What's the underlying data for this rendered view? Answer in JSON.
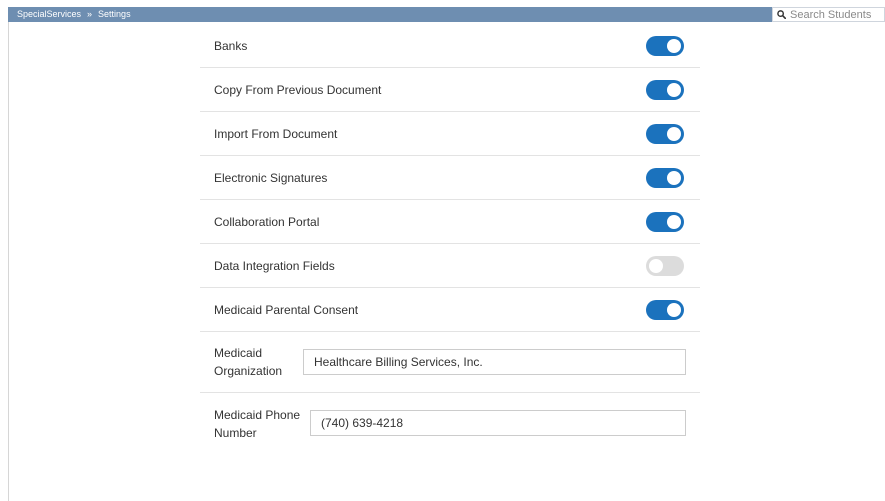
{
  "breadcrumb": {
    "app": "SpecialServices",
    "separator": "»",
    "page": "Settings"
  },
  "search": {
    "placeholder": "Search Students",
    "icon": "search-icon"
  },
  "colors": {
    "topbar": "#6e8eb1",
    "toggle_on": "#1b72bd",
    "toggle_off": "#dcdcdc"
  },
  "settings": [
    {
      "label": "Banks",
      "enabled": true
    },
    {
      "label": "Copy From Previous Document",
      "enabled": true
    },
    {
      "label": "Import From Document",
      "enabled": true
    },
    {
      "label": "Electronic Signatures",
      "enabled": true
    },
    {
      "label": "Collaboration Portal",
      "enabled": true
    },
    {
      "label": "Data Integration Fields",
      "enabled": false
    },
    {
      "label": "Medicaid Parental Consent",
      "enabled": true
    }
  ],
  "medicaid_org": {
    "label_line1": "Medicaid",
    "label_line2": "Organization",
    "value": "Healthcare Billing Services, Inc."
  },
  "medicaid_phone": {
    "label_line1": "Medicaid Phone",
    "label_line2": "Number",
    "value": "(740) 639-4218"
  }
}
